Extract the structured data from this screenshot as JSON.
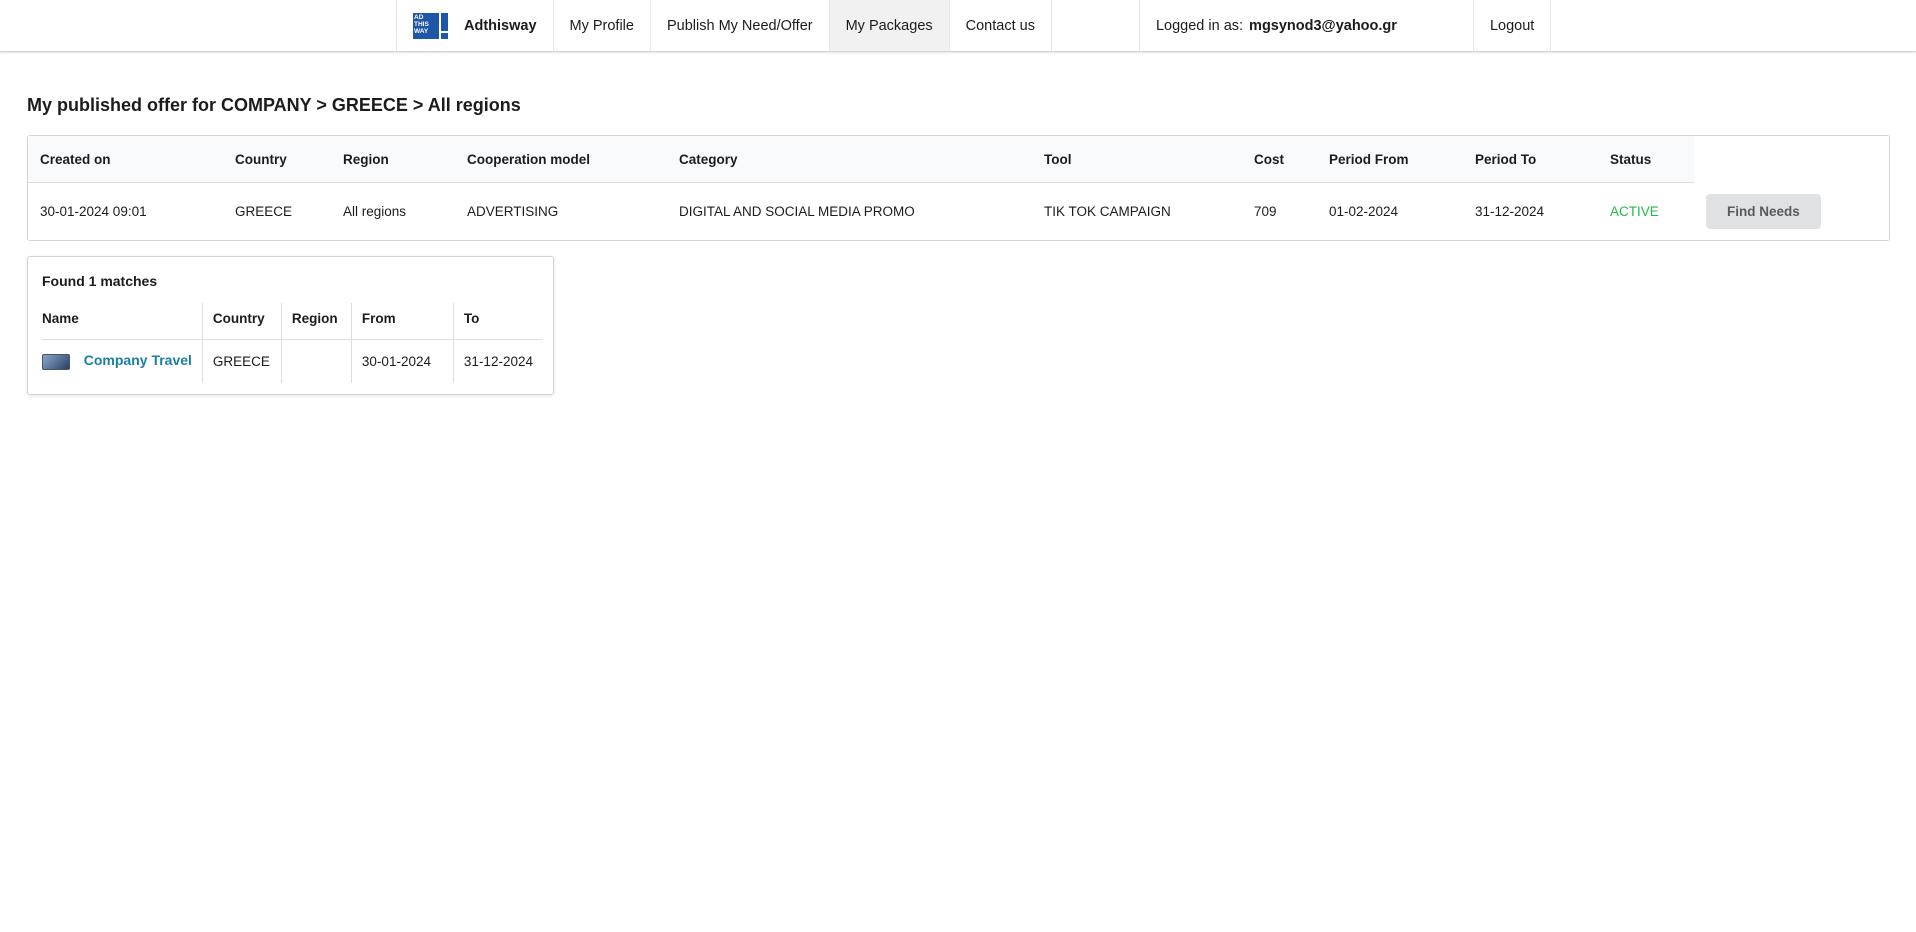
{
  "nav": {
    "brand": "Adthisway",
    "logo_text": "AD THIS WAY",
    "items": [
      "My Profile",
      "Publish My Need/Offer",
      "My Packages",
      "Contact us"
    ],
    "active_item": "My Packages",
    "logged_in_label": "Logged in as:",
    "logged_in_email": "mgsynod3@yahoo.gr",
    "logout": "Logout"
  },
  "page_title": "My published offer for COMPANY > GREECE > All regions",
  "offer_table": {
    "headers": [
      "Created on",
      "Country",
      "Region",
      "Cooperation model",
      "Category",
      "Tool",
      "Cost",
      "Period From",
      "Period To",
      "Status"
    ],
    "row": [
      "30-01-2024 09:01",
      "GREECE",
      "All regions",
      "ADVERTISING",
      "DIGITAL AND SOCIAL MEDIA PROMO",
      "TIK TOK CAMPAIGN",
      "709",
      "01-02-2024",
      "31-12-2024",
      "ACTIVE"
    ],
    "action_button": "Find Needs"
  },
  "matches": {
    "found_label": "Found 1 matches",
    "headers": [
      "Name",
      "Country",
      "Region",
      "From",
      "To"
    ],
    "rows": [
      {
        "name": "Company Travel",
        "country": "GREECE",
        "region": "",
        "from": "30-01-2024",
        "to": "31-12-2024"
      }
    ]
  },
  "colors": {
    "status_active": "#21ba45",
    "link": "#1a7ea7",
    "logo": "#1e56a8"
  }
}
